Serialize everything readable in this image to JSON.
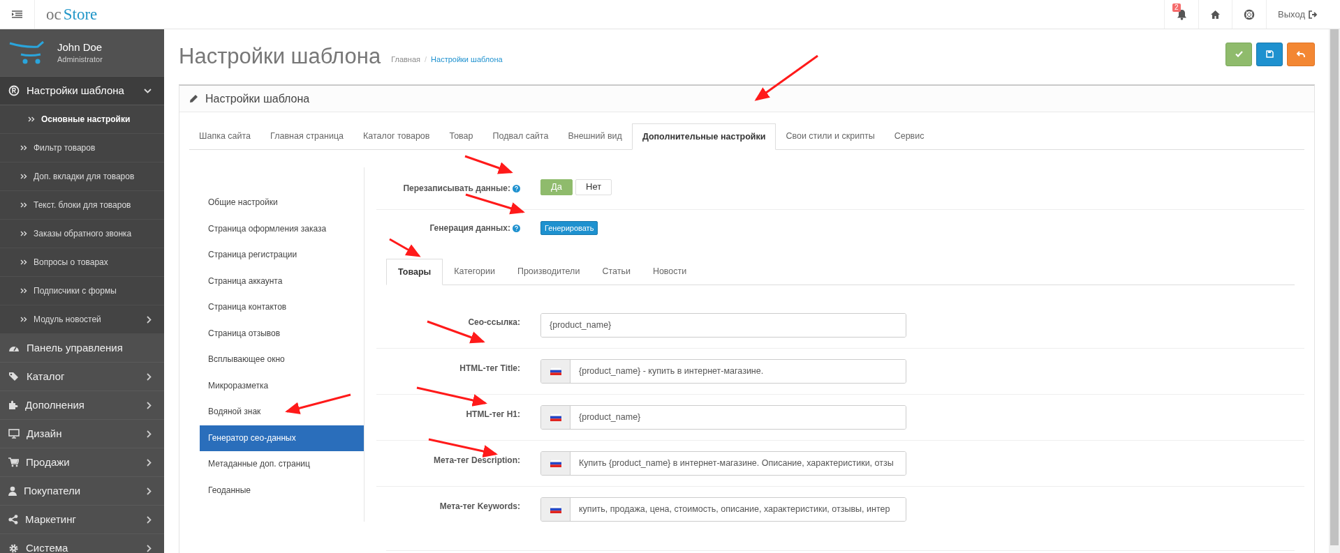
{
  "header": {
    "logo_prefix": "oc",
    "logo_name": "Store",
    "notification_count": "2",
    "logout": "Выход"
  },
  "user": {
    "name": "John Doe",
    "role": "Administrator"
  },
  "sidebar": {
    "items": [
      {
        "label": "Настройки шаблона",
        "expandable": true,
        "expanded": true,
        "children": [
          {
            "label": "Основные настройки",
            "selected": true,
            "expandable": false
          },
          {
            "label": "Фильтр товаров",
            "selected": false,
            "expandable": false
          },
          {
            "label": "Доп. вкладки для товаров",
            "selected": false,
            "expandable": false
          },
          {
            "label": "Текст. блоки для товаров",
            "selected": false,
            "expandable": false
          },
          {
            "label": "Заказы обратного звонка",
            "selected": false,
            "expandable": false
          },
          {
            "label": "Вопросы о товарах",
            "selected": false,
            "expandable": false
          },
          {
            "label": "Подписчики с формы",
            "selected": false,
            "expandable": false
          },
          {
            "label": "Модуль новостей",
            "selected": false,
            "expandable": true
          }
        ]
      },
      {
        "label": "Панель управления",
        "expandable": false,
        "expanded": false
      },
      {
        "label": "Каталог",
        "expandable": true,
        "expanded": false
      },
      {
        "label": "Дополнения",
        "expandable": true,
        "expanded": false
      },
      {
        "label": "Дизайн",
        "expandable": true,
        "expanded": false
      },
      {
        "label": "Продажи",
        "expandable": true,
        "expanded": false
      },
      {
        "label": "Покупатели",
        "expandable": true,
        "expanded": false
      },
      {
        "label": "Маркетинг",
        "expandable": true,
        "expanded": false
      },
      {
        "label": "Система",
        "expandable": true,
        "expanded": false
      }
    ]
  },
  "page": {
    "title": "Настройки шаблона",
    "breadcrumb_separator": "/",
    "breadcrumbs": [
      {
        "label": "Главная",
        "active": false
      },
      {
        "label": "Настройки шаблона",
        "active": true
      }
    ]
  },
  "panel": {
    "title": "Настройки шаблона",
    "tabs": [
      {
        "label": "Шапка сайта",
        "selected": false
      },
      {
        "label": "Главная страница",
        "selected": false
      },
      {
        "label": "Каталог товаров",
        "selected": false
      },
      {
        "label": "Товар",
        "selected": false
      },
      {
        "label": "Подвал сайта",
        "selected": false
      },
      {
        "label": "Внешний вид",
        "selected": false
      },
      {
        "label": "Дополнительные настройки",
        "selected": true
      },
      {
        "label": "Свои стили и скрипты",
        "selected": false
      },
      {
        "label": "Сервис",
        "selected": false
      }
    ],
    "menu": [
      {
        "label": "Общие настройки",
        "selected": false
      },
      {
        "label": "Страница оформления заказа",
        "selected": false
      },
      {
        "label": "Страница регистрации",
        "selected": false
      },
      {
        "label": "Страница аккаунта",
        "selected": false
      },
      {
        "label": "Страница контактов",
        "selected": false
      },
      {
        "label": "Страница отзывов",
        "selected": false
      },
      {
        "label": "Всплывающее окно",
        "selected": false
      },
      {
        "label": "Микроразметка",
        "selected": false
      },
      {
        "label": "Водяной знак",
        "selected": false
      },
      {
        "label": "Генератор сео-данных",
        "selected": true
      },
      {
        "label": "Метаданные доп. страниц",
        "selected": false
      },
      {
        "label": "Геоданные",
        "selected": false
      }
    ],
    "overwrite": {
      "label": "Перезаписывать данные:",
      "options": [
        {
          "label": "Да",
          "selected": true
        },
        {
          "label": "Нет",
          "selected": false
        }
      ]
    },
    "generate": {
      "label": "Генерация данных:",
      "button": "Генерировать"
    },
    "subtabs": [
      {
        "label": "Товары",
        "selected": true
      },
      {
        "label": "Категории",
        "selected": false
      },
      {
        "label": "Производители",
        "selected": false
      },
      {
        "label": "Статьи",
        "selected": false
      },
      {
        "label": "Новости",
        "selected": false
      }
    ],
    "fields": [
      {
        "label": "Сео-ссылка:",
        "value": "{product_name}",
        "kind": "plain"
      },
      {
        "label": "HTML-тег Title:",
        "value": "{product_name} - купить в интернет-магазине.",
        "kind": "flag"
      },
      {
        "label": "HTML-тег H1:",
        "value": "{product_name}",
        "kind": "flag"
      },
      {
        "label": "Мета-тег Description:",
        "value": "Купить {product_name} в интернет-магазине. Описание, характеристики, отзы",
        "kind": "flag"
      },
      {
        "label": "Мета-тег Keywords:",
        "value": "купить, продажа, цена, стоимость, описание, характеристики, отзывы, интер",
        "kind": "flag"
      }
    ]
  }
}
